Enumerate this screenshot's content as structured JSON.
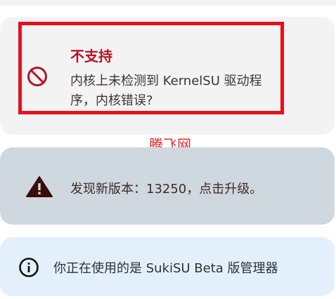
{
  "status_card": {
    "title": "不支持",
    "description": "内核上未检测到 KernelSU 驱动程序，内核错误?",
    "icon": "forbidden-icon",
    "accent_color": "#b41325"
  },
  "watermark": {
    "text": "腾飞网",
    "color": "#e8292b"
  },
  "update_card": {
    "text": "发现新版本：13250，点击升级。",
    "icon": "warning-icon",
    "background": "#cfd8de"
  },
  "info_card": {
    "text": "你正在使用的是 SukiSU Beta 版管理器",
    "icon": "info-icon",
    "background": "#e3f0fb"
  },
  "highlight_color": "#e5111c"
}
